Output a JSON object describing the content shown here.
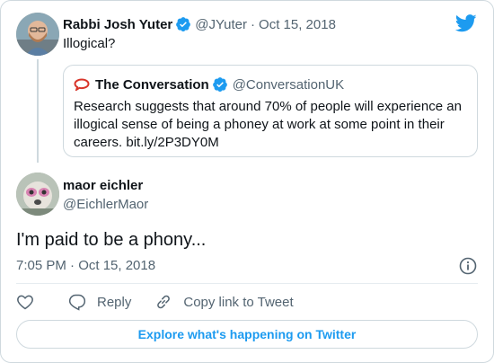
{
  "colors": {
    "accent": "#1d9bf0",
    "text": "#0f1419",
    "muted": "#536471",
    "border": "#cfd9de",
    "conversation_red": "#d8352a"
  },
  "parent_tweet": {
    "name": "Rabbi Josh Yuter",
    "handle": "@JYuter",
    "date": "Oct 15, 2018",
    "separator": "·",
    "text": "Illogical?",
    "avatar_icon": "avatar-photo"
  },
  "quoted_tweet": {
    "name": "The Conversation",
    "handle": "@ConversationUK",
    "text": "Research suggests that around 70% of people will experience an illogical sense of being a phoney at work at some point in their careers. bit.ly/2P3DY0M",
    "icon": "speech-bubble-icon"
  },
  "main_tweet": {
    "name": "maor eichler",
    "handle": "@EichlerMaor",
    "text": "I'm paid to be a phony...",
    "timestamp": "7:05 PM · Oct 15, 2018",
    "avatar_icon": "avatar-photo"
  },
  "actions": {
    "like_icon": "heart-icon",
    "reply_label": "Reply",
    "copy_label": "Copy link to Tweet"
  },
  "explore_label": "Explore what's happening on Twitter"
}
